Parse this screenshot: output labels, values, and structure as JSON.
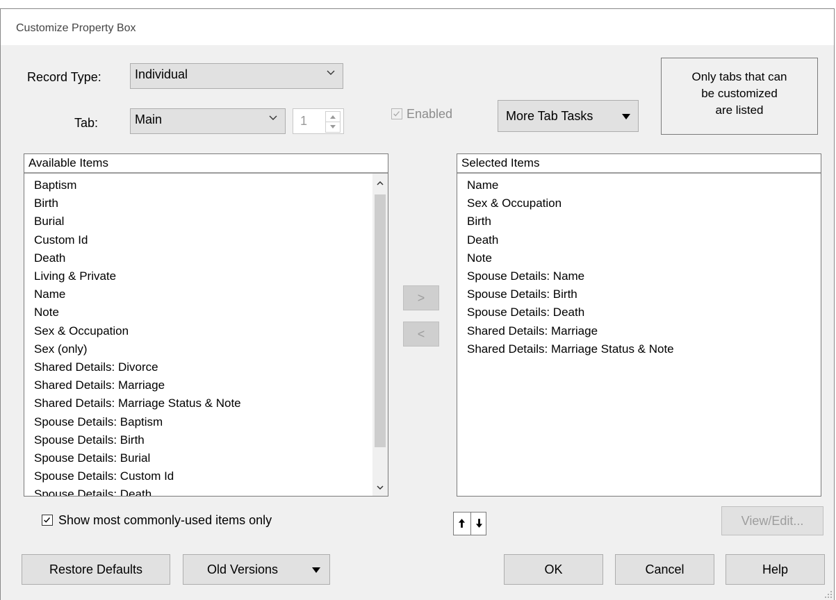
{
  "window": {
    "title": "Customize Property Box"
  },
  "form": {
    "record_type_label": "Record Type:",
    "record_type_value": "Individual",
    "tab_label": "Tab:",
    "tab_value": "Main",
    "tab_number": "1",
    "enabled_label": "Enabled",
    "more_tab_tasks": "More Tab Tasks",
    "note_lines": [
      "Only tabs that can",
      "be customized",
      "are listed"
    ]
  },
  "available": {
    "header": "Available Items",
    "items": [
      "Baptism",
      "Birth",
      "Burial",
      "Custom Id",
      "Death",
      "Living & Private",
      "Name",
      "Note",
      "Sex & Occupation",
      "Sex (only)",
      "Shared Details: Divorce",
      "Shared Details: Marriage",
      "Shared Details: Marriage Status & Note",
      "Spouse Details: Baptism",
      "Spouse Details: Birth",
      "Spouse Details: Burial",
      "Spouse Details: Custom Id",
      "Spouse Details: Death"
    ]
  },
  "selected": {
    "header": "Selected Items",
    "items": [
      "Name",
      "Sex & Occupation",
      "Birth",
      "Death",
      "Note",
      "Spouse Details: Name",
      "Spouse Details: Birth",
      "Spouse Details: Death",
      "Shared Details: Marriage",
      "Shared Details: Marriage Status & Note"
    ]
  },
  "transfer": {
    "add": ">",
    "remove": "<"
  },
  "options": {
    "common_only_label": "Show most commonly-used items only"
  },
  "buttons": {
    "view_edit": "View/Edit...",
    "restore_defaults": "Restore Defaults",
    "old_versions": "Old Versions",
    "ok": "OK",
    "cancel": "Cancel",
    "help": "Help"
  },
  "icons": {
    "dropdown": "chevron-down-icon",
    "caret": "caret-down-icon",
    "move_up": "arrow-up-icon",
    "move_down": "arrow-down-icon",
    "check": "checkmark-icon"
  }
}
